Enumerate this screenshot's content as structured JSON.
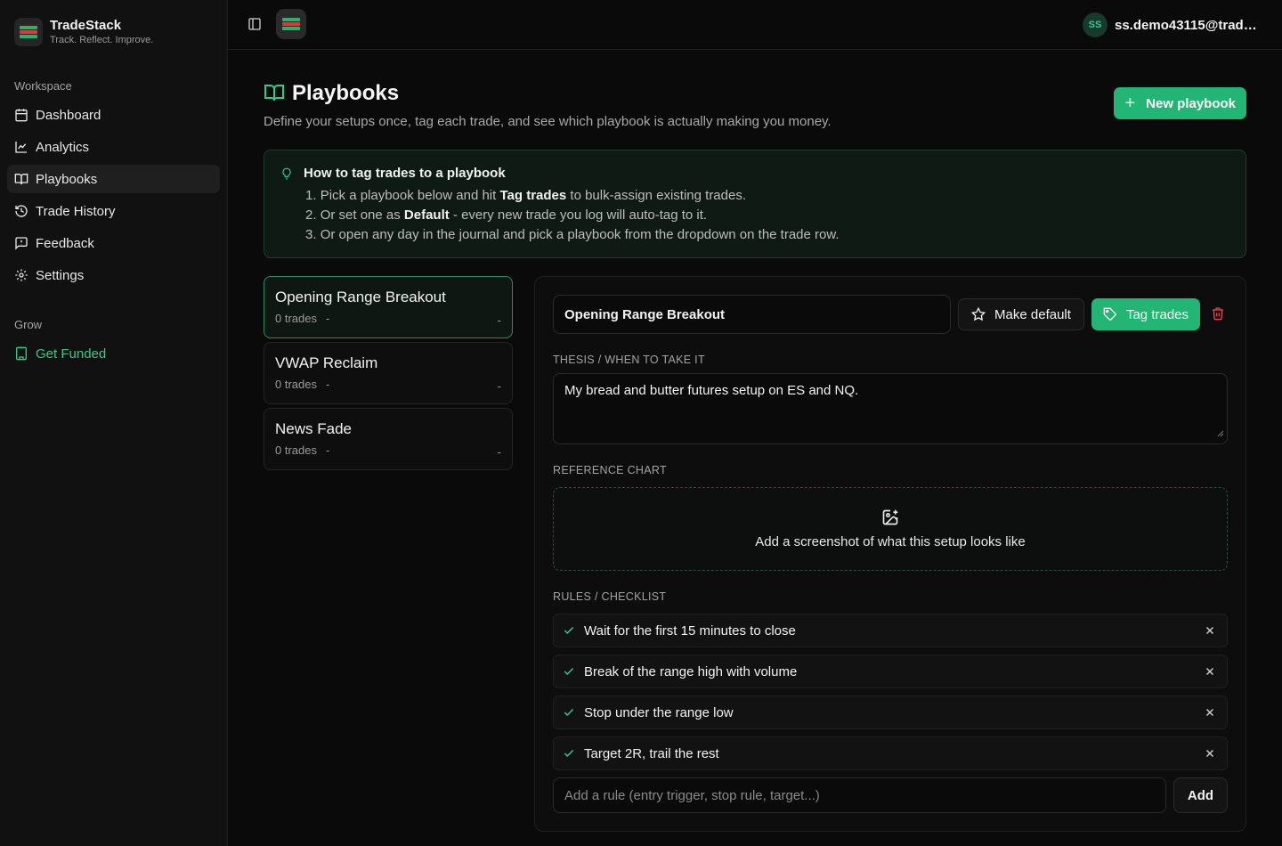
{
  "brand": {
    "name": "TradeStack",
    "tagline": "Track. Reflect. Improve."
  },
  "sidebar": {
    "workspace_label": "Workspace",
    "items": [
      {
        "label": "Dashboard",
        "icon": "calendar-icon"
      },
      {
        "label": "Analytics",
        "icon": "chart-line-icon"
      },
      {
        "label": "Playbooks",
        "icon": "book-open-icon",
        "active": true
      },
      {
        "label": "Trade History",
        "icon": "history-icon"
      },
      {
        "label": "Feedback",
        "icon": "message-icon"
      },
      {
        "label": "Settings",
        "icon": "gear-icon"
      }
    ],
    "grow_label": "Grow",
    "grow_items": [
      {
        "label": "Get Funded",
        "icon": "building-icon"
      }
    ]
  },
  "header": {
    "user_initials": "SS",
    "user_email": "ss.demo43115@trade..."
  },
  "page": {
    "title": "Playbooks",
    "subtitle": "Define your setups once, tag each trade, and see which playbook is actually making you money.",
    "new_button": "New playbook"
  },
  "tip": {
    "title": "How to tag trades to a playbook",
    "steps": [
      {
        "num": "1.",
        "pre": "Pick a playbook below and hit",
        "bold": "Tag trades",
        "post": "to bulk-assign existing trades."
      },
      {
        "num": "2.",
        "pre": "Or set one as",
        "bold": "Default",
        "post": "- every new trade you log will auto-tag to it."
      },
      {
        "num": "3.",
        "pre": "Or open any day in the journal and pick a playbook from the dropdown on the trade row.",
        "bold": "",
        "post": ""
      }
    ]
  },
  "playbooks": [
    {
      "name": "Opening Range Breakout",
      "trades": "0 trades",
      "dash": "-",
      "right": "-",
      "active": true
    },
    {
      "name": "VWAP Reclaim",
      "trades": "0 trades",
      "dash": "-",
      "right": "-"
    },
    {
      "name": "News Fade",
      "trades": "0 trades",
      "dash": "-",
      "right": "-"
    }
  ],
  "detail": {
    "name_value": "Opening Range Breakout",
    "make_default": "Make default",
    "tag_trades": "Tag trades",
    "thesis_label": "THESIS / WHEN TO TAKE IT",
    "thesis_value": "My bread and butter futures setup on ES and NQ.",
    "chart_label": "REFERENCE CHART",
    "chart_prompt": "Add a screenshot of what this setup looks like",
    "rules_label": "RULES / CHECKLIST",
    "rules": [
      "Wait for the first 15 minutes to close",
      "Break of the range high with volume",
      "Stop under the range low",
      "Target 2R, trail the rest"
    ],
    "add_placeholder": "Add a rule (entry trigger, stop rule, target...)",
    "add_button": "Add"
  },
  "colors": {
    "accent": "#22b573",
    "danger": "#e5484d",
    "background": "#0a0a0a"
  }
}
